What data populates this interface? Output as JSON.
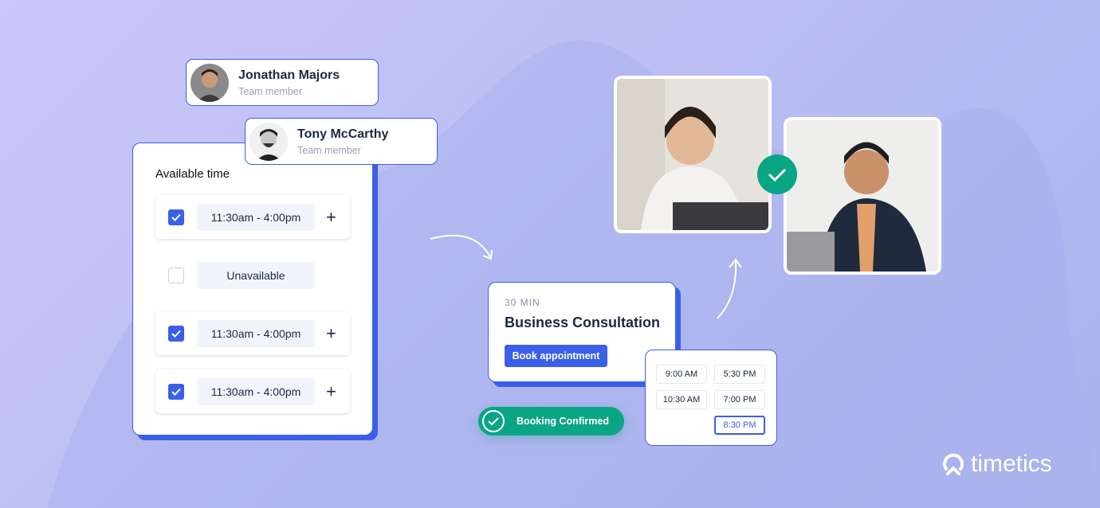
{
  "colors": {
    "accent": "#3b5fe8",
    "success": "#0aa585",
    "text": "#1c2745",
    "muted": "#9aa0b3"
  },
  "members": [
    {
      "name": "Jonathan Majors",
      "role": "Team member",
      "icon": "avatar-photo"
    },
    {
      "name": "Tony McCarthy",
      "role": "Team member",
      "icon": "avatar-photo"
    }
  ],
  "availability": {
    "title": "Available time",
    "rows": [
      {
        "checked": true,
        "label": "11:30am - 4:00pm",
        "icon": "plus-icon",
        "plus": "+"
      },
      {
        "checked": false,
        "label": "Unavailable"
      },
      {
        "checked": true,
        "label": "11:30am - 4:00pm",
        "icon": "plus-icon",
        "plus": "+"
      },
      {
        "checked": true,
        "label": "11:30am - 4:00pm",
        "icon": "plus-icon",
        "plus": "+"
      }
    ]
  },
  "event": {
    "duration": "30 MIN",
    "title": "Business Consultation",
    "button": "Book appointment"
  },
  "time_slots": [
    "9:00 AM",
    "5:30 PM",
    "10:30 AM",
    "7:00 PM",
    "8:30 PM"
  ],
  "selected_slot": "8:30 PM",
  "confirmation": {
    "label": "Booking Confirmed",
    "icon": "check-circle-icon"
  },
  "brand": {
    "name": "timetics",
    "icon": "timetics-logo-icon"
  }
}
